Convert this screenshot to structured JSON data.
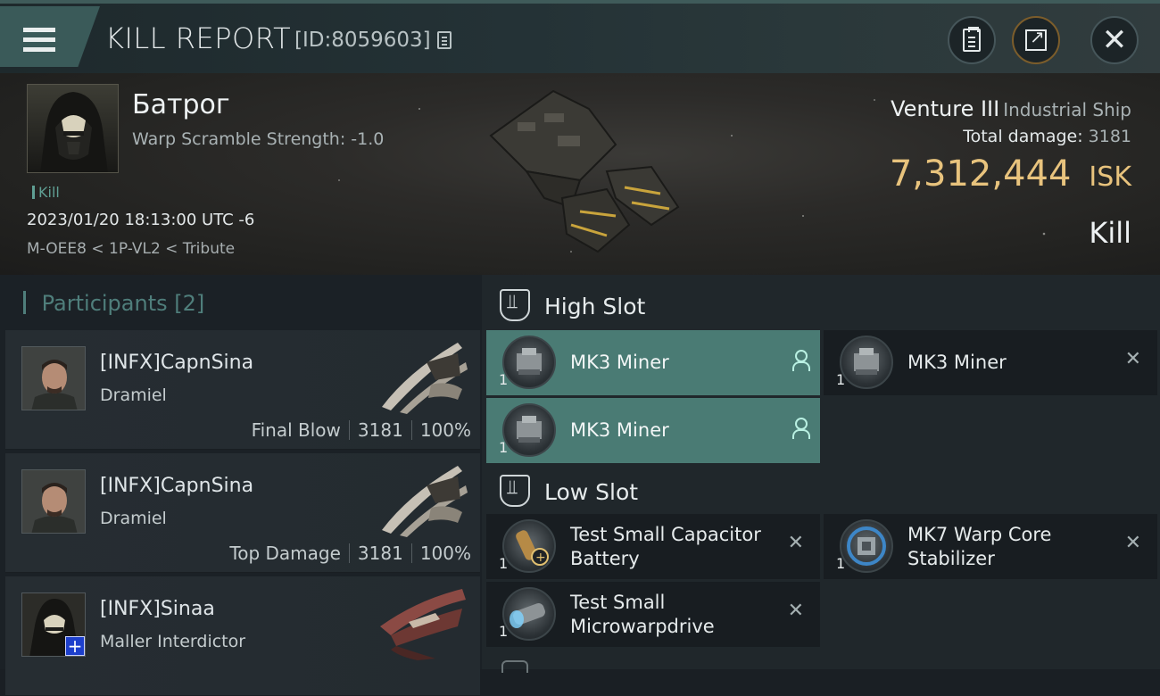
{
  "header": {
    "title": "KILL REPORT",
    "report_id": "[ID:8059603]"
  },
  "victim": {
    "name": "Батрог",
    "warp_scramble": "Warp Scramble Strength: -1.0",
    "tag": "Kill",
    "datetime": "2023/01/20 18:13:00 UTC -6",
    "location": "M-OEE8 < 1P-VL2 < Tribute",
    "ship": "Venture III",
    "ship_class": "Industrial Ship",
    "total_damage_label": "Total damage:",
    "total_damage": "3181",
    "isk_value": "7,312,444",
    "isk_unit": "ISK",
    "result": "Kill"
  },
  "participants": {
    "label": "Participants",
    "count": "[2]",
    "items": [
      {
        "name": "[INFX]CapnSina",
        "ship": "Dramiel",
        "role": "Final Blow",
        "damage": "3181",
        "percent": "100%"
      },
      {
        "name": "[INFX]CapnSina",
        "ship": "Dramiel",
        "role": "Top Damage",
        "damage": "3181",
        "percent": "100%"
      },
      {
        "name": "[INFX]Sinaa",
        "ship": "Maller Interdictor"
      }
    ]
  },
  "fitting": {
    "high_slot_label": "High Slot",
    "low_slot_label": "Low Slot",
    "high": [
      {
        "name": "MK3 Miner",
        "qty": "1",
        "status": "person-icon",
        "active": true
      },
      {
        "name": "MK3 Miner",
        "qty": "1",
        "status": "close-icon",
        "active": false
      },
      {
        "name": "MK3 Miner",
        "qty": "1",
        "status": "person-icon",
        "active": true
      }
    ],
    "low": [
      {
        "name": "Test Small Capacitor Battery",
        "qty": "1",
        "status": "close-icon"
      },
      {
        "name": "MK7 Warp Core Stabilizer",
        "qty": "1",
        "status": "close-icon"
      },
      {
        "name": "Test Small Microwarpdrive",
        "qty": "1",
        "status": "close-icon"
      }
    ]
  },
  "icons": {
    "close": "✕"
  },
  "colors": {
    "accent_teal": "#4a7b74",
    "isk_gold": "#e8c37d"
  }
}
